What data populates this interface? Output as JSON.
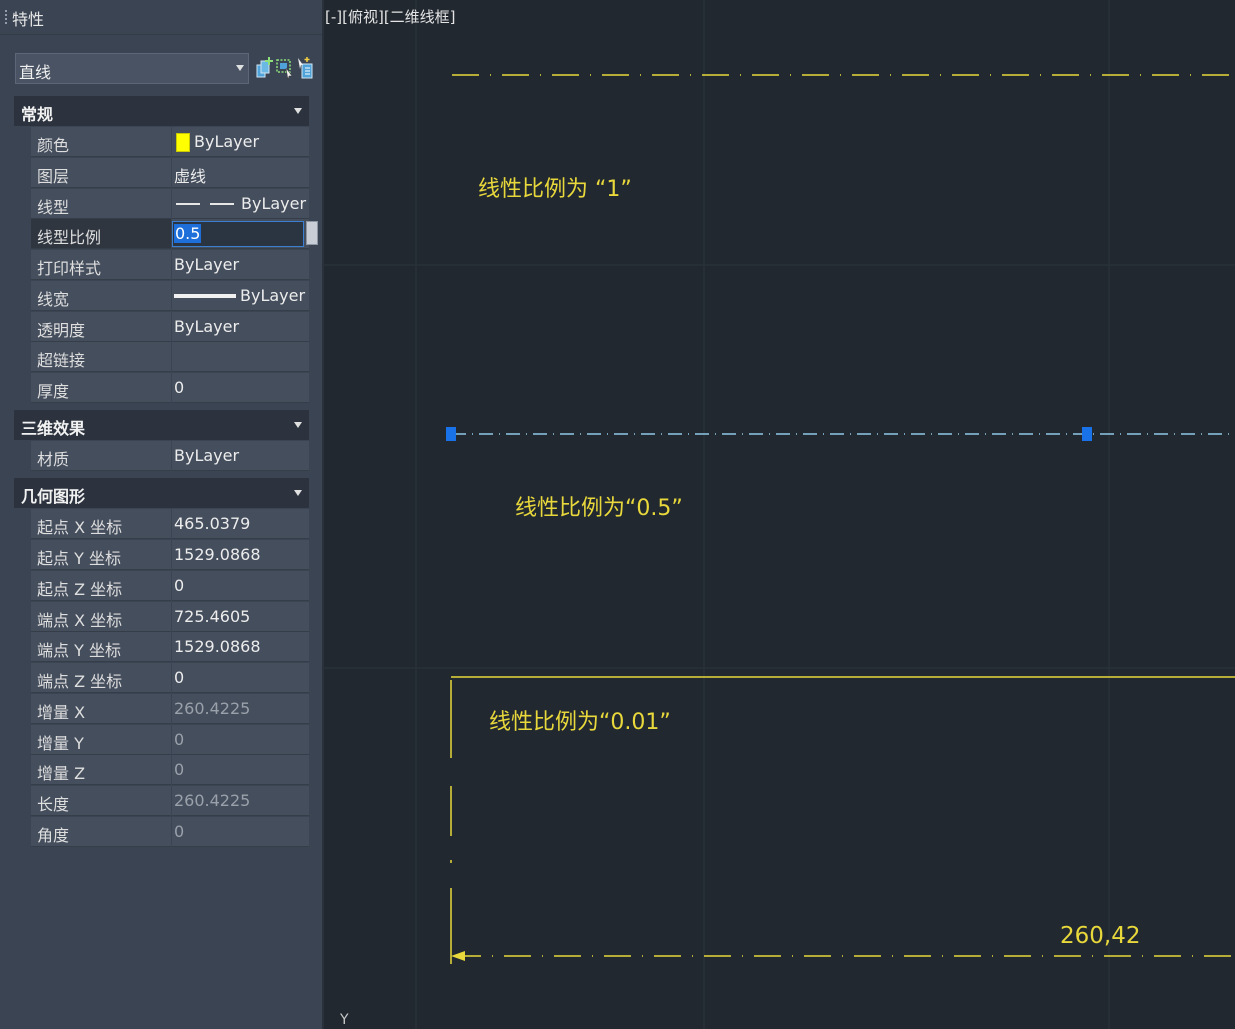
{
  "palette": {
    "title": "特性",
    "object_type": "直线",
    "toolbar_icons": [
      "add-selection-icon",
      "quick-select-icon",
      "toggle-pickadd-icon"
    ],
    "sections": {
      "general": {
        "title": "常规",
        "rows": [
          {
            "label": "颜色",
            "value": "ByLayer"
          },
          {
            "label": "图层",
            "value": "虚线"
          },
          {
            "label": "线型",
            "value": "ByLayer"
          },
          {
            "label": "线型比例",
            "value": "0.5"
          },
          {
            "label": "打印样式",
            "value": "ByLayer"
          },
          {
            "label": "线宽",
            "value": "ByLayer"
          },
          {
            "label": "透明度",
            "value": "ByLayer"
          },
          {
            "label": "超链接",
            "value": ""
          },
          {
            "label": "厚度",
            "value": "0"
          }
        ]
      },
      "threed": {
        "title": "三维效果",
        "rows": [
          {
            "label": "材质",
            "value": "ByLayer"
          }
        ]
      },
      "geometry": {
        "title": "几何图形",
        "rows": [
          {
            "label": "起点 X 坐标",
            "value": "465.0379"
          },
          {
            "label": "起点 Y 坐标",
            "value": "1529.0868"
          },
          {
            "label": "起点 Z 坐标",
            "value": "0"
          },
          {
            "label": "端点 X 坐标",
            "value": "725.4605"
          },
          {
            "label": "端点 Y 坐标",
            "value": "1529.0868"
          },
          {
            "label": "端点 Z 坐标",
            "value": "0"
          },
          {
            "label": "增量 X",
            "value": "260.4225"
          },
          {
            "label": "增量 Y",
            "value": "0"
          },
          {
            "label": "增量 Z",
            "value": "0"
          },
          {
            "label": "长度",
            "value": "260.4225"
          },
          {
            "label": "角度",
            "value": "0"
          }
        ]
      }
    }
  },
  "canvas": {
    "viewport_label": "[-][俯视][二维线框]",
    "annotations": {
      "scale_1": "线性比例为 “1”",
      "scale_05": "线性比例为“0.5”",
      "scale_001": "线性比例为“0.01”"
    },
    "dimension_text": "260,42",
    "ucs_glyph": "Y"
  },
  "colors": {
    "background": "#212830",
    "palette": "#3b4453",
    "cad_yellow": "#e8d83b",
    "selected_line": "#8fc8e8",
    "grip": "#1a72e8",
    "color_swatch": "#ffff00"
  }
}
